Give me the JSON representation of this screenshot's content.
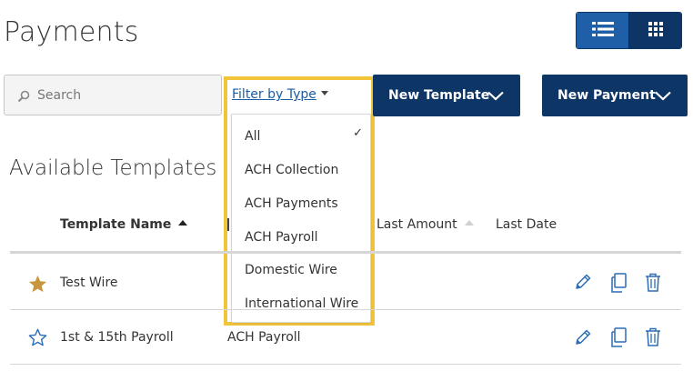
{
  "header": {
    "title": "Payments"
  },
  "search": {
    "placeholder": "Search",
    "value": ""
  },
  "filter": {
    "trigger_label": "Filter by Type",
    "selected": "All",
    "options": [
      "All",
      "ACH Collection",
      "ACH Payments",
      "ACH Payroll",
      "Domestic Wire",
      "International Wire"
    ],
    "highlight_color": "#f1c43a"
  },
  "actions": {
    "new_template_label": "New Template",
    "new_payment_label": "New Payment"
  },
  "templates": {
    "section_title": "Available Templates",
    "columns": {
      "name": "Template Name",
      "last_amount": "Last Amount",
      "last_date": "Last Date"
    },
    "rows": [
      {
        "favorite": true,
        "name": "Test Wire",
        "type": ""
      },
      {
        "favorite": false,
        "name": "1st & 15th Payroll",
        "type": "ACH Payroll"
      }
    ]
  },
  "colors": {
    "brand_navy": "#0d3566",
    "active_toggle": "#1f5fa8",
    "link_blue": "#1a5da6",
    "action_icon_blue": "#2c6cb5",
    "favorite_gold": "#c8963e"
  }
}
